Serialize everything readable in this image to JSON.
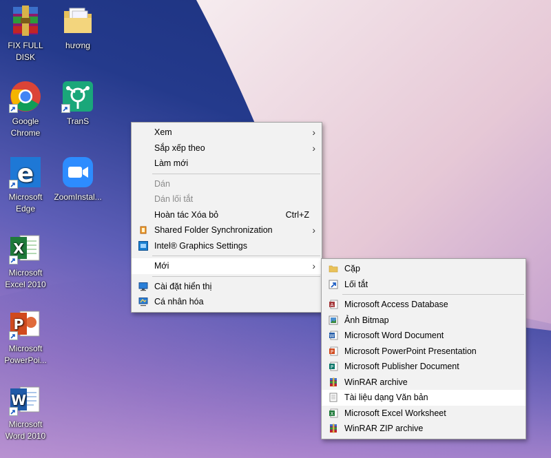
{
  "desktop": {
    "icons": [
      {
        "label": "FIX FULL DISK",
        "icon": "winrar-icon"
      },
      {
        "label": "hương",
        "icon": "folder-icon"
      },
      {
        "label": "Google Chrome",
        "icon": "chrome-icon"
      },
      {
        "label": "TranS",
        "icon": "trans-icon"
      },
      {
        "label": "Microsoft Edge",
        "icon": "edge-icon"
      },
      {
        "label": "ZoomInstal...",
        "icon": "zoom-icon"
      },
      {
        "label": "Microsoft Excel 2010",
        "icon": "excel-icon"
      },
      {
        "label": "Microsoft PowerPoi...",
        "icon": "powerpoint-icon"
      },
      {
        "label": "Microsoft Word 2010",
        "icon": "word-icon"
      }
    ]
  },
  "context_menu": {
    "view": "Xem",
    "sort_by": "Sắp xếp theo",
    "refresh": "Làm mới",
    "paste": "Dán",
    "paste_shortcut": "Dán lối tắt",
    "undo_delete": "Hoàn tác Xóa bỏ",
    "undo_shortcut": "Ctrl+Z",
    "shared_folder_sync": "Shared Folder Synchronization",
    "intel_graphics": "Intel® Graphics Settings",
    "new": "Mới",
    "display_settings": "Cài đặt hiển thị",
    "personalize": "Cá nhân hóa"
  },
  "new_submenu": {
    "folder": "Cặp",
    "shortcut": "Lối tắt",
    "access_db": "Microsoft Access Database",
    "bitmap": "Ảnh Bitmap",
    "word_doc": "Microsoft Word Document",
    "ppt": "Microsoft PowerPoint Presentation",
    "publisher": "Microsoft Publisher Document",
    "winrar": "WinRAR archive",
    "text_doc": "Tài liệu dạng Văn bản",
    "excel": "Microsoft Excel Worksheet",
    "winrar_zip": "WinRAR ZIP archive"
  },
  "colors": {
    "menu_bg": "#f2f2f2",
    "menu_hover": "#ffffff",
    "disabled_text": "#8a8a8a"
  }
}
